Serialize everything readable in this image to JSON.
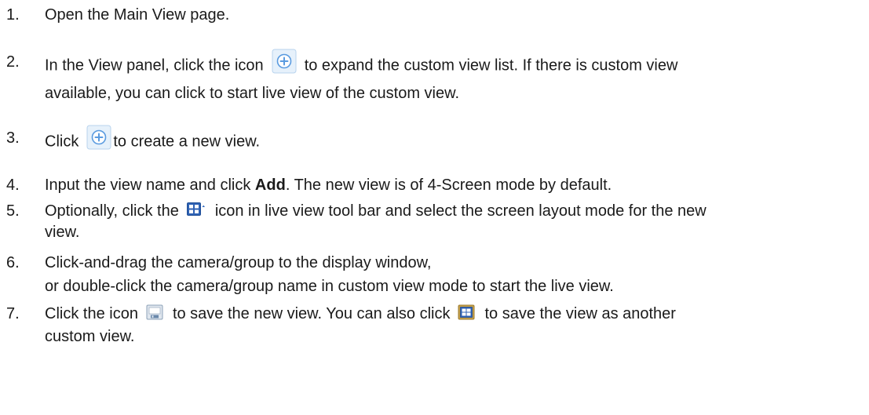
{
  "steps": [
    {
      "num": "1.",
      "lines": [
        "Open the Main View page."
      ]
    },
    {
      "num": "2.",
      "a": "In the View panel, click the icon",
      "b": "to expand the custom view list. If there is custom view",
      "c": "available, you can click to start live view of the custom view.",
      "icon": "plus-icon"
    },
    {
      "num": "3.",
      "a": "Click",
      "b": "to create a new view.",
      "icon": "plus-icon"
    },
    {
      "num": "4.",
      "a": "Input the view name and click ",
      "bold": "Add",
      "b": ". The new view is of 4-Screen mode by default."
    },
    {
      "num": "5.",
      "a": "Optionally, click the",
      "b": "icon in live view tool bar and select the screen layout mode for the new",
      "c": "view.",
      "icon": "screen-layout-icon"
    },
    {
      "num": "6.",
      "a": "Click-and-drag the camera/group to the display window,",
      "b": "or double-click the camera/group name in custom view mode to start the live view."
    },
    {
      "num": "7.",
      "a": "Click the icon",
      "b": "to save the new view. You can also click",
      "c": "to save the view as another",
      "d": "custom view.",
      "icon1": "save-view-icon",
      "icon2": "save-as-view-icon"
    }
  ],
  "colors": {
    "text": "#1a1a1a",
    "icon_blue": "#4a8fd4",
    "icon_bg": "#eaf3fc"
  }
}
